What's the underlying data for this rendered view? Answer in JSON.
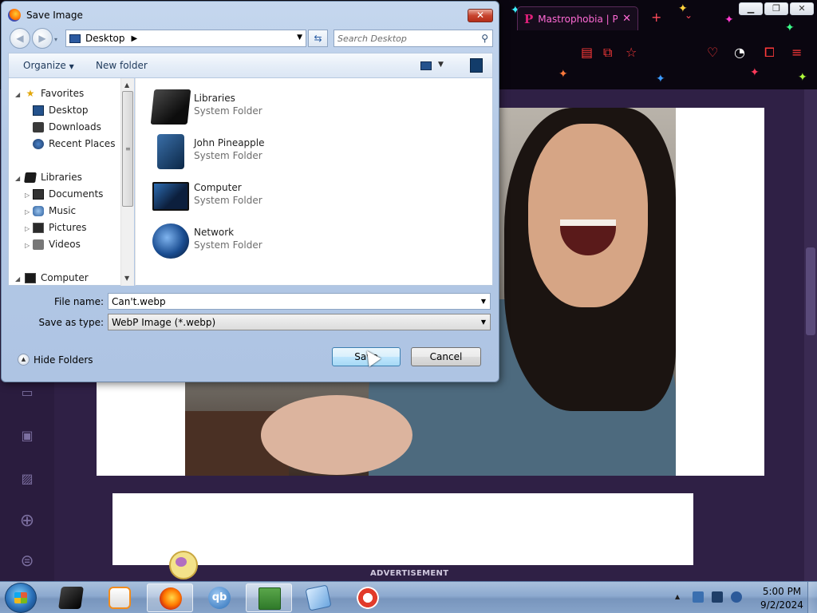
{
  "dialog": {
    "title": "Save Image",
    "address": "Desktop",
    "search_placeholder": "Search Desktop",
    "toolbar": {
      "organize": "Organize",
      "new_folder": "New folder"
    },
    "nav_tree": [
      {
        "label": "Favorites",
        "icon": "star-icon"
      },
      {
        "label": "Desktop",
        "icon": "desktop-icon"
      },
      {
        "label": "Downloads",
        "icon": "downloads-icon"
      },
      {
        "label": "Recent Places",
        "icon": "recent-places-icon"
      },
      {
        "label": "Libraries",
        "icon": "libraries-icon"
      },
      {
        "label": "Documents",
        "icon": "documents-icon"
      },
      {
        "label": "Music",
        "icon": "music-icon"
      },
      {
        "label": "Pictures",
        "icon": "pictures-icon"
      },
      {
        "label": "Videos",
        "icon": "videos-icon"
      },
      {
        "label": "Computer",
        "icon": "computer-icon"
      }
    ],
    "items": [
      {
        "name": "Libraries",
        "type": "System Folder"
      },
      {
        "name": "John Pineapple",
        "type": "System Folder"
      },
      {
        "name": "Computer",
        "type": "System Folder"
      },
      {
        "name": "Network",
        "type": "System Folder"
      }
    ],
    "file_name_label": "File name:",
    "file_name": "Can't.webp",
    "save_type_label": "Save as type:",
    "save_type": "WebP Image (*.webp)",
    "hide_folders": "Hide Folders",
    "save": "Save",
    "cancel": "Cancel"
  },
  "browser": {
    "tab_title": "Mastrophobia | Ph",
    "tab_favicon": "P",
    "ad_label": "ADVERTISEMENT"
  },
  "taskbar": {
    "time": "5:00 PM",
    "date": "9/2/2024",
    "qb_label": "qb"
  }
}
